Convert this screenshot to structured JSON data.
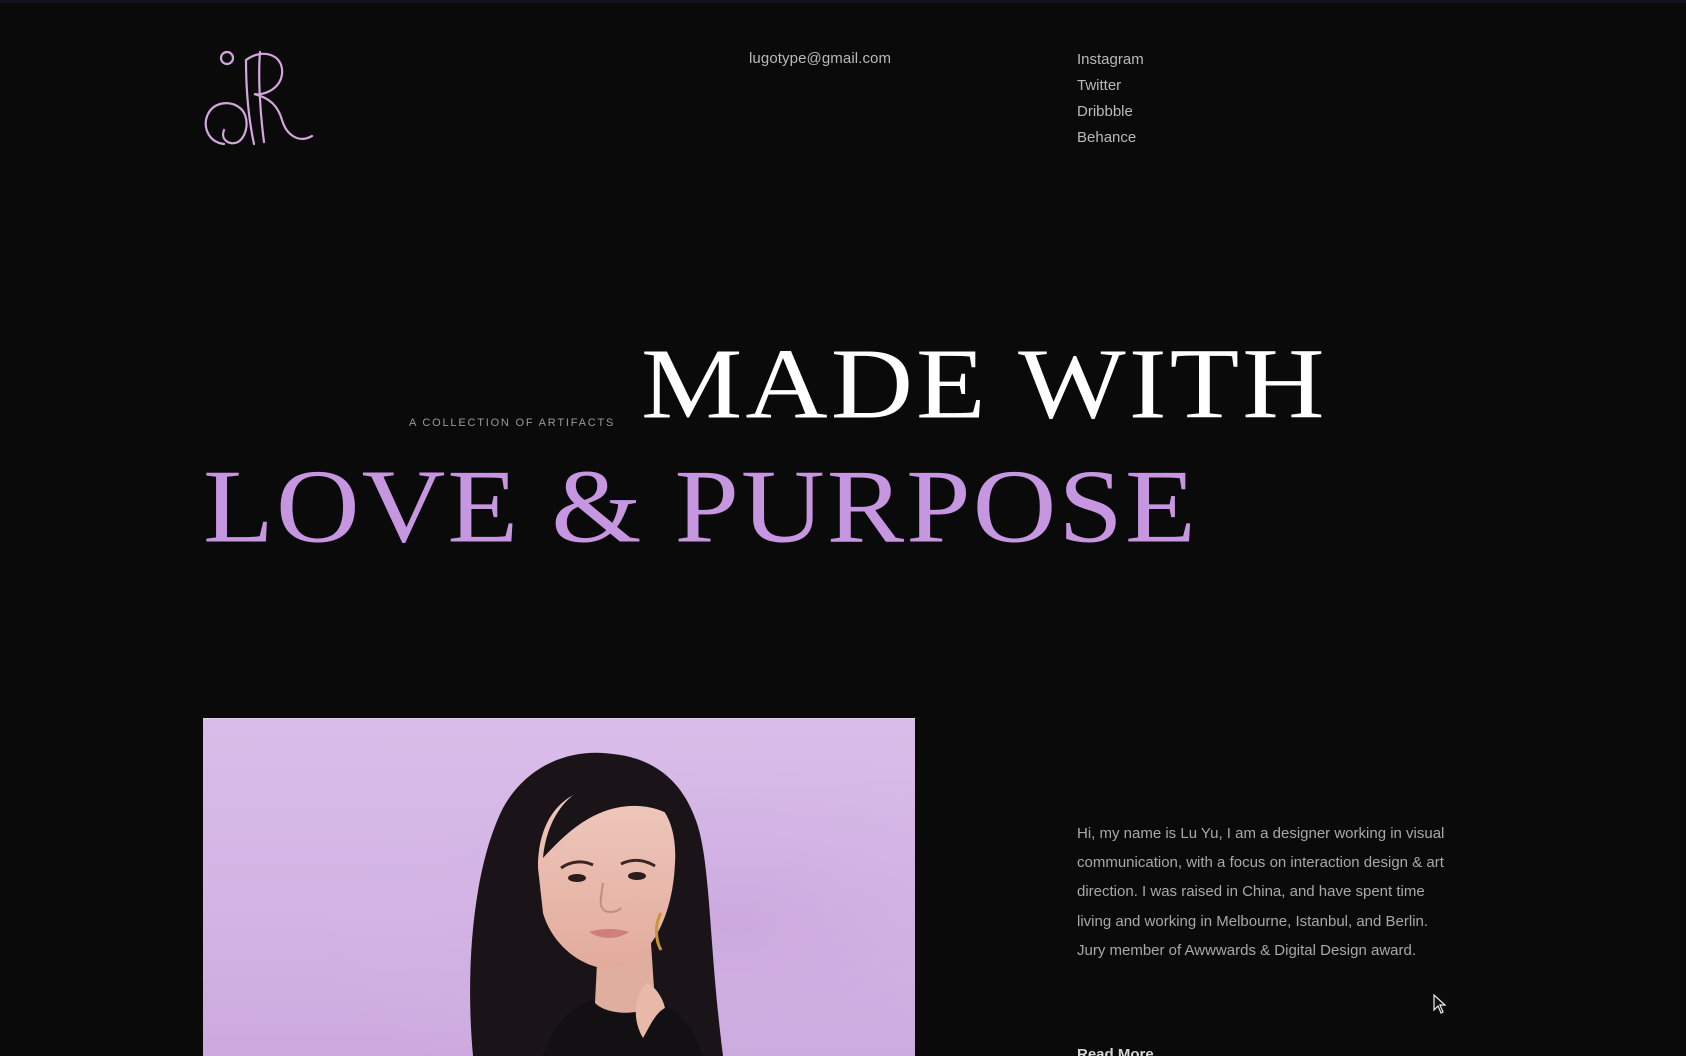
{
  "header": {
    "logo_icon": "monogram-logo-icon",
    "email": "lugotype@gmail.com",
    "social_links": [
      {
        "label": "Instagram"
      },
      {
        "label": "Twitter"
      },
      {
        "label": "Dribbble"
      },
      {
        "label": "Behance"
      }
    ]
  },
  "hero": {
    "eyebrow": "A COLLECTION OF ARTIFACTS",
    "headline_line1": "MADE WITH",
    "headline_line2": "LOVE & PURPOSE"
  },
  "about": {
    "bio": "Hi, my name is Lu Yu, I am a designer working in visual communication, with a focus on interaction design & art direction. I was raised in China, and have spent time living and working in Melbourne, Istanbul, and Berlin. Jury member of Awwwards & Digital Design award.",
    "read_more": "Read More"
  },
  "colors": {
    "background": "#0a0a0b",
    "accent_lavender": "#c697e0",
    "headline_white": "#ffffff",
    "text_muted": "#b9b9b9",
    "photo_background": "#d5b6e6"
  }
}
